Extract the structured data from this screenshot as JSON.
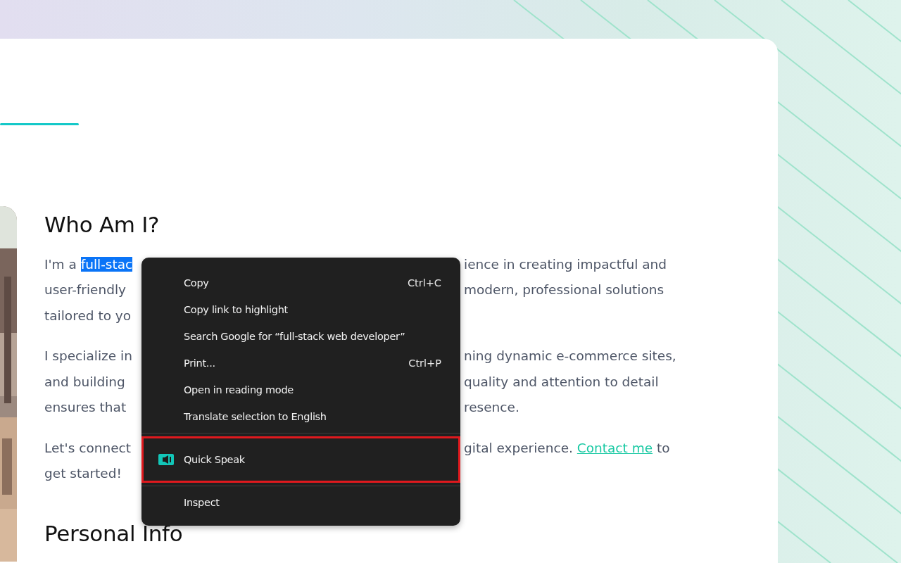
{
  "about": {
    "heading": "Who Am I?",
    "paragraphs": [
      [
        {
          "left": [
            {
              "text": "I'm a ",
              "selected": false
            },
            {
              "text": "full-stac",
              "selected": true
            }
          ],
          "right": [
            {
              "text": "ience in creating impactful and",
              "kind": "text"
            }
          ]
        },
        {
          "left": [
            {
              "text": "user-friendly",
              "selected": false
            }
          ],
          "right": [
            {
              "text": "modern, professional solutions",
              "kind": "text"
            }
          ]
        },
        {
          "left": [
            {
              "text": "tailored to yo",
              "selected": false
            }
          ]
        }
      ],
      [
        {
          "left": [
            {
              "text": "I specialize in",
              "selected": false
            }
          ],
          "right": [
            {
              "text": "ning dynamic e-commerce sites,",
              "kind": "text"
            }
          ]
        },
        {
          "left": [
            {
              "text": "and building",
              "selected": false
            }
          ],
          "right": [
            {
              "text": "quality and attention to detail",
              "kind": "text"
            }
          ]
        },
        {
          "left": [
            {
              "text": "ensures that",
              "selected": false
            }
          ],
          "right": [
            {
              "text": "resence.",
              "kind": "text"
            }
          ]
        }
      ],
      [
        {
          "left": [
            {
              "text": "Let's connect",
              "selected": false
            }
          ],
          "right": [
            {
              "text": "gital experience. ",
              "kind": "text"
            },
            {
              "text": "Contact me",
              "kind": "link"
            },
            {
              "text": " to",
              "kind": "text"
            }
          ]
        },
        {
          "left": [
            {
              "text": "get started!",
              "selected": false
            }
          ]
        }
      ]
    ],
    "next_heading": "Personal Info"
  },
  "context_menu": {
    "groups": [
      [
        {
          "kind": "item",
          "label": "Copy",
          "shortcut": "Ctrl+C",
          "highlighted": false
        },
        {
          "kind": "item",
          "label": "Copy link to highlight",
          "highlighted": false
        },
        {
          "kind": "item",
          "label": "Search Google for “full-stack web developer”",
          "highlighted": false
        },
        {
          "kind": "item",
          "label": "Print...",
          "shortcut": "Ctrl+P",
          "highlighted": false
        },
        {
          "kind": "item",
          "label": "Open in reading mode",
          "highlighted": false
        },
        {
          "kind": "item",
          "label": "Translate selection to English",
          "highlighted": false
        }
      ],
      [
        {
          "kind": "extension",
          "label": "Quick Speak",
          "highlighted": true
        }
      ],
      [
        {
          "kind": "item",
          "label": "Inspect",
          "highlighted": false
        }
      ]
    ]
  }
}
